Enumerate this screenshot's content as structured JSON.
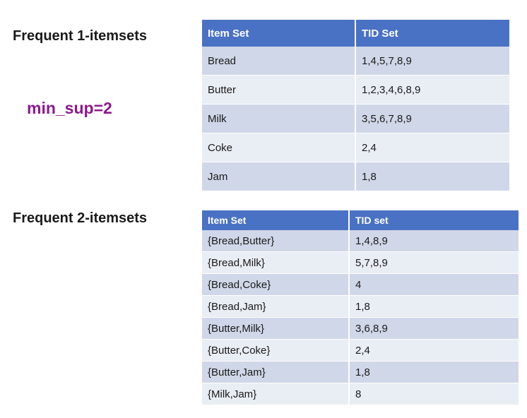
{
  "heading_1": "Frequent 1-itemsets",
  "min_sup": "min_sup=2",
  "heading_2": "Frequent 2-itemsets",
  "table_1": {
    "headers": [
      "Item Set",
      "TID Set"
    ],
    "rows": [
      [
        "Bread",
        "1,4,5,7,8,9"
      ],
      [
        "Butter",
        "1,2,3,4,6,8,9"
      ],
      [
        "Milk",
        "3,5,6,7,8,9"
      ],
      [
        "Coke",
        "2,4"
      ],
      [
        "Jam",
        "1,8"
      ]
    ]
  },
  "table_2": {
    "headers": [
      "Item Set",
      "TID set"
    ],
    "rows": [
      [
        "{Bread,Butter}",
        "1,4,8,9"
      ],
      [
        "{Bread,Milk}",
        "5,7,8,9"
      ],
      [
        "{Bread,Coke}",
        "4"
      ],
      [
        "{Bread,Jam}",
        "1,8"
      ],
      [
        "{Butter,Milk}",
        "3,6,8,9"
      ],
      [
        "{Butter,Coke}",
        "2,4"
      ],
      [
        "{Butter,Jam}",
        "1,8"
      ],
      [
        "{Milk,Jam}",
        "8"
      ]
    ]
  }
}
